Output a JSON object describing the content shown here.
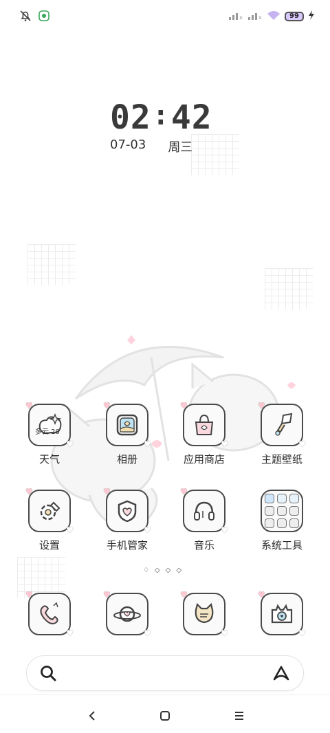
{
  "status_bar": {
    "battery_level": "99",
    "icons": [
      "mute-bell-icon",
      "wechat-icon",
      "signal-1-icon",
      "signal-2-icon",
      "wifi-icon",
      "battery-icon",
      "charging-icon"
    ]
  },
  "clock": {
    "hours": "02",
    "minutes": "42",
    "date": "07-03",
    "weekday": "周三"
  },
  "apps": [
    {
      "label": "天气",
      "icon": "weather-icon",
      "overlay_text": "多云 20"
    },
    {
      "label": "相册",
      "icon": "gallery-icon"
    },
    {
      "label": "应用商店",
      "icon": "app-store-icon"
    },
    {
      "label": "主题壁纸",
      "icon": "theme-brush-icon"
    },
    {
      "label": "设置",
      "icon": "settings-gear-icon"
    },
    {
      "label": "手机管家",
      "icon": "security-shield-icon"
    },
    {
      "label": "音乐",
      "icon": "music-headphones-icon"
    },
    {
      "label": "系统工具",
      "icon": "system-tools-folder-icon"
    }
  ],
  "dock": [
    {
      "icon": "phone-icon"
    },
    {
      "icon": "messages-planet-icon"
    },
    {
      "icon": "contacts-cat-icon"
    },
    {
      "icon": "camera-icon"
    }
  ],
  "pager": {
    "pages": 4,
    "current": 1
  },
  "search": {
    "icons": [
      "search-icon",
      "assistant-icon"
    ]
  },
  "nav": {
    "icons": [
      "back-icon",
      "home-icon",
      "recents-icon"
    ]
  },
  "colors": {
    "accent_pink": "#ffc8d3",
    "icon_stroke": "#4a4a4a",
    "battery_fill": "#d9c9ff"
  }
}
